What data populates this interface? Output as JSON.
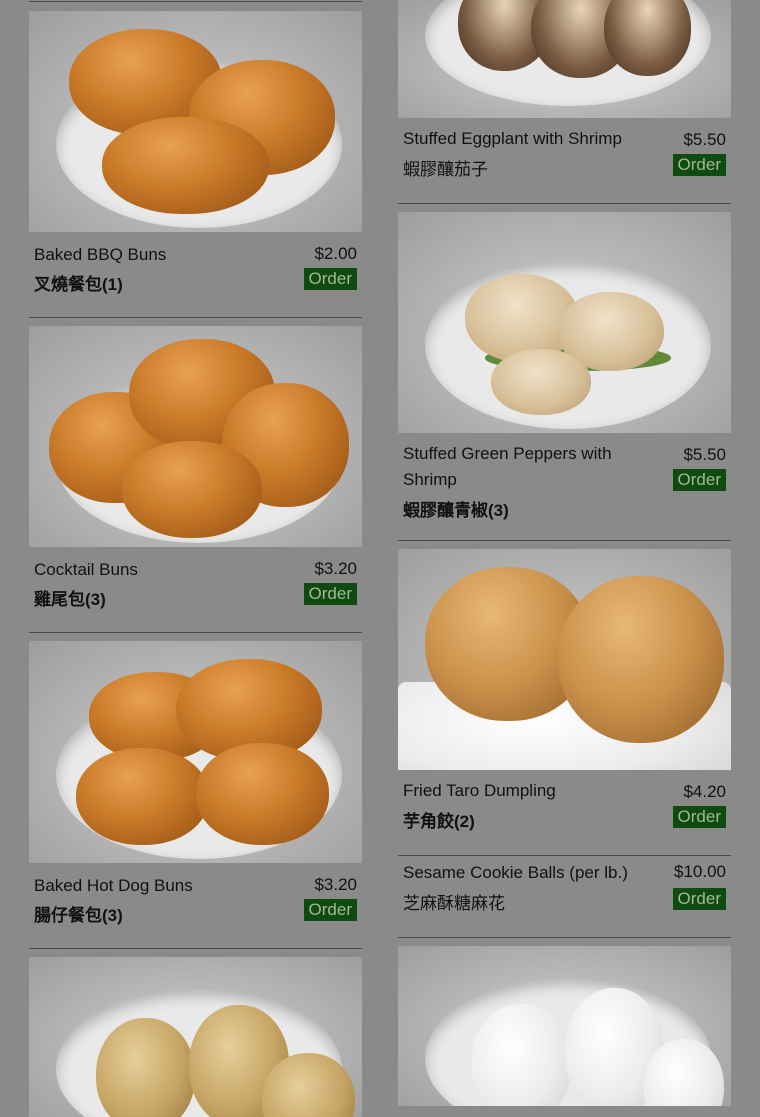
{
  "left_items": [
    {
      "name": "Baked BBQ Buns",
      "chinese": "叉燒餐包",
      "count": "(1)",
      "price": "$2.00",
      "order": "Order"
    },
    {
      "name": "Cocktail Buns",
      "chinese": "雞尾包",
      "count": "(3)",
      "price": "$3.20",
      "order": "Order"
    },
    {
      "name": "Baked Hot Dog Buns",
      "chinese": "腸仔餐包",
      "count": "(3)",
      "price": "$3.20",
      "order": "Order"
    }
  ],
  "right_items": [
    {
      "name": "Stuffed Eggplant with Shrimp",
      "chinese": "蝦膠釀茄子",
      "count": "",
      "price": "$5.50",
      "order": "Order"
    },
    {
      "name": "Stuffed Green Peppers with Shrimp",
      "chinese": "蝦膠釀青椒",
      "count": "(3)",
      "price": "$5.50",
      "order": "Order"
    },
    {
      "name": "Fried Taro Dumpling",
      "chinese": "芋角餃",
      "count": "(2)",
      "price": "$4.20",
      "order": "Order"
    },
    {
      "name": "Sesame Cookie Balls (per lb.)",
      "chinese": "芝麻酥糖麻花",
      "count": "",
      "price": "$10.00",
      "order": "Order"
    }
  ]
}
